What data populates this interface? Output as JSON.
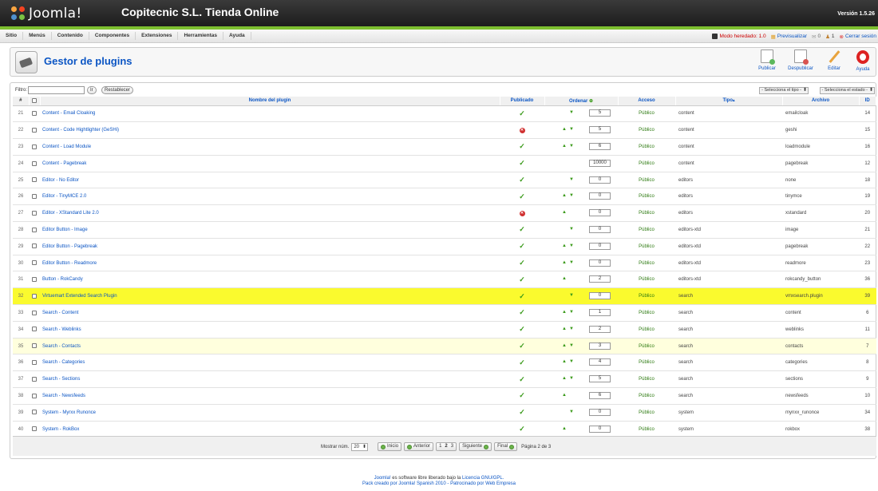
{
  "header": {
    "logo_text": "Joomla!",
    "site_title": "Copitecnic S.L. Tienda Online",
    "version": "Versión 1.5.26"
  },
  "menu": {
    "items": [
      "Sitio",
      "Menús",
      "Contenido",
      "Componentes",
      "Extensiones",
      "Herramientas",
      "Ayuda"
    ],
    "right": {
      "template_mode": "Modo heredado: 1.0",
      "preview": "Previsualizar",
      "messages": "0",
      "users": "1",
      "logout": "Cerrar sesión"
    }
  },
  "toolbar": {
    "title": "Gestor de plugins",
    "buttons": [
      "Publicar",
      "Despublicar",
      "Editar",
      "Ayuda"
    ]
  },
  "filter": {
    "label": "Filtro:",
    "value": "",
    "go": "Ir",
    "reset": "Restablecer",
    "type_select": "- Selecciona el tipo -",
    "state_select": "- Selecciona el estado -"
  },
  "table": {
    "headers": {
      "num": "#",
      "name": "Nombre del plugin",
      "published": "Publicado",
      "order": "Ordenar",
      "access": "Acceso",
      "type": "Tipo",
      "file": "Archivo",
      "id": "ID"
    },
    "rows": [
      {
        "num": "21",
        "name": "Content - Email Cloaking",
        "published": true,
        "up": false,
        "down": true,
        "order": "5",
        "access": "Público",
        "type": "content",
        "file": "emailcloak",
        "id": "14"
      },
      {
        "num": "22",
        "name": "Content - Code Hightlighter (GeSHi)",
        "published": false,
        "up": true,
        "down": true,
        "order": "5",
        "access": "Público",
        "type": "content",
        "file": "geshi",
        "id": "15"
      },
      {
        "num": "23",
        "name": "Content - Load Module",
        "published": true,
        "up": true,
        "down": true,
        "order": "6",
        "access": "Público",
        "type": "content",
        "file": "loadmodule",
        "id": "16"
      },
      {
        "num": "24",
        "name": "Content - Pagebreak",
        "published": true,
        "up": false,
        "down": false,
        "order": "10000",
        "access": "Público",
        "type": "content",
        "file": "pagebreak",
        "id": "12"
      },
      {
        "num": "25",
        "name": "Editor - No Editor",
        "published": true,
        "up": false,
        "down": true,
        "order": "0",
        "access": "Público",
        "type": "editors",
        "file": "none",
        "id": "18"
      },
      {
        "num": "26",
        "name": "Editor - TinyMCE 2.0",
        "published": true,
        "up": true,
        "down": true,
        "order": "0",
        "access": "Público",
        "type": "editors",
        "file": "tinymce",
        "id": "19"
      },
      {
        "num": "27",
        "name": "Editor - XStandard Lite 2.0",
        "published": false,
        "up": true,
        "down": false,
        "order": "0",
        "access": "Público",
        "type": "editors",
        "file": "xstandard",
        "id": "20"
      },
      {
        "num": "28",
        "name": "Editor Button - Image",
        "published": true,
        "up": false,
        "down": true,
        "order": "0",
        "access": "Público",
        "type": "editors-xtd",
        "file": "image",
        "id": "21"
      },
      {
        "num": "29",
        "name": "Editor Button - Pagebreak",
        "published": true,
        "up": true,
        "down": true,
        "order": "0",
        "access": "Público",
        "type": "editors-xtd",
        "file": "pagebreak",
        "id": "22"
      },
      {
        "num": "30",
        "name": "Editor Button - Readmore",
        "published": true,
        "up": true,
        "down": true,
        "order": "0",
        "access": "Público",
        "type": "editors-xtd",
        "file": "readmore",
        "id": "23"
      },
      {
        "num": "31",
        "name": "Button - RokCandy",
        "published": true,
        "up": true,
        "down": false,
        "order": "2",
        "access": "Público",
        "type": "editors-xtd",
        "file": "rokcandy_button",
        "id": "36"
      },
      {
        "num": "32",
        "name": "Virtuemart Extended Search Plugin",
        "published": true,
        "up": false,
        "down": true,
        "order": "0",
        "access": "Público",
        "type": "search",
        "file": "vmxsearch.plugin",
        "id": "39",
        "highlight": "strong"
      },
      {
        "num": "33",
        "name": "Search - Content",
        "published": true,
        "up": true,
        "down": true,
        "order": "1",
        "access": "Público",
        "type": "search",
        "file": "content",
        "id": "6"
      },
      {
        "num": "34",
        "name": "Search - Weblinks",
        "published": true,
        "up": true,
        "down": true,
        "order": "2",
        "access": "Público",
        "type": "search",
        "file": "weblinks",
        "id": "11"
      },
      {
        "num": "35",
        "name": "Search - Contacts",
        "published": true,
        "up": true,
        "down": true,
        "order": "3",
        "access": "Público",
        "type": "search",
        "file": "contacts",
        "id": "7",
        "highlight": "light"
      },
      {
        "num": "36",
        "name": "Search - Categories",
        "published": true,
        "up": true,
        "down": true,
        "order": "4",
        "access": "Público",
        "type": "search",
        "file": "categories",
        "id": "8"
      },
      {
        "num": "37",
        "name": "Search - Sections",
        "published": true,
        "up": true,
        "down": true,
        "order": "5",
        "access": "Público",
        "type": "search",
        "file": "sections",
        "id": "9"
      },
      {
        "num": "38",
        "name": "Search - Newsfeeds",
        "published": true,
        "up": true,
        "down": false,
        "order": "6",
        "access": "Público",
        "type": "search",
        "file": "newsfeeds",
        "id": "10"
      },
      {
        "num": "39",
        "name": "System - Myrxx Runonce",
        "published": true,
        "up": false,
        "down": true,
        "order": "0",
        "access": "Público",
        "type": "system",
        "file": "mynxx_runonce",
        "id": "34"
      },
      {
        "num": "40",
        "name": "System - RokBox",
        "published": true,
        "up": true,
        "down": false,
        "order": "0",
        "access": "Público",
        "type": "system",
        "file": "rokbox",
        "id": "38"
      }
    ]
  },
  "pagination": {
    "show_label": "Mostrar núm.",
    "show_value": "20",
    "start": "Inicio",
    "prev": "Anterior",
    "pages": [
      "1",
      "2",
      "3"
    ],
    "current": "2",
    "next": "Siguiente",
    "end": "Final",
    "page_info": "Página 2 de 3"
  },
  "footer": {
    "line1_pre": "Joomla!",
    "line1_mid": " es software libre liberado bajo la ",
    "line1_link": "Licencia GNU/GPL.",
    "line2": "Pack creado por Joomla! Spanish 2010 - Patrocinado por Web Empresa"
  },
  "colors": {
    "accent": "#0b55c4",
    "green_bar": "#7dbf2f",
    "highlight": "#fafa2e"
  }
}
